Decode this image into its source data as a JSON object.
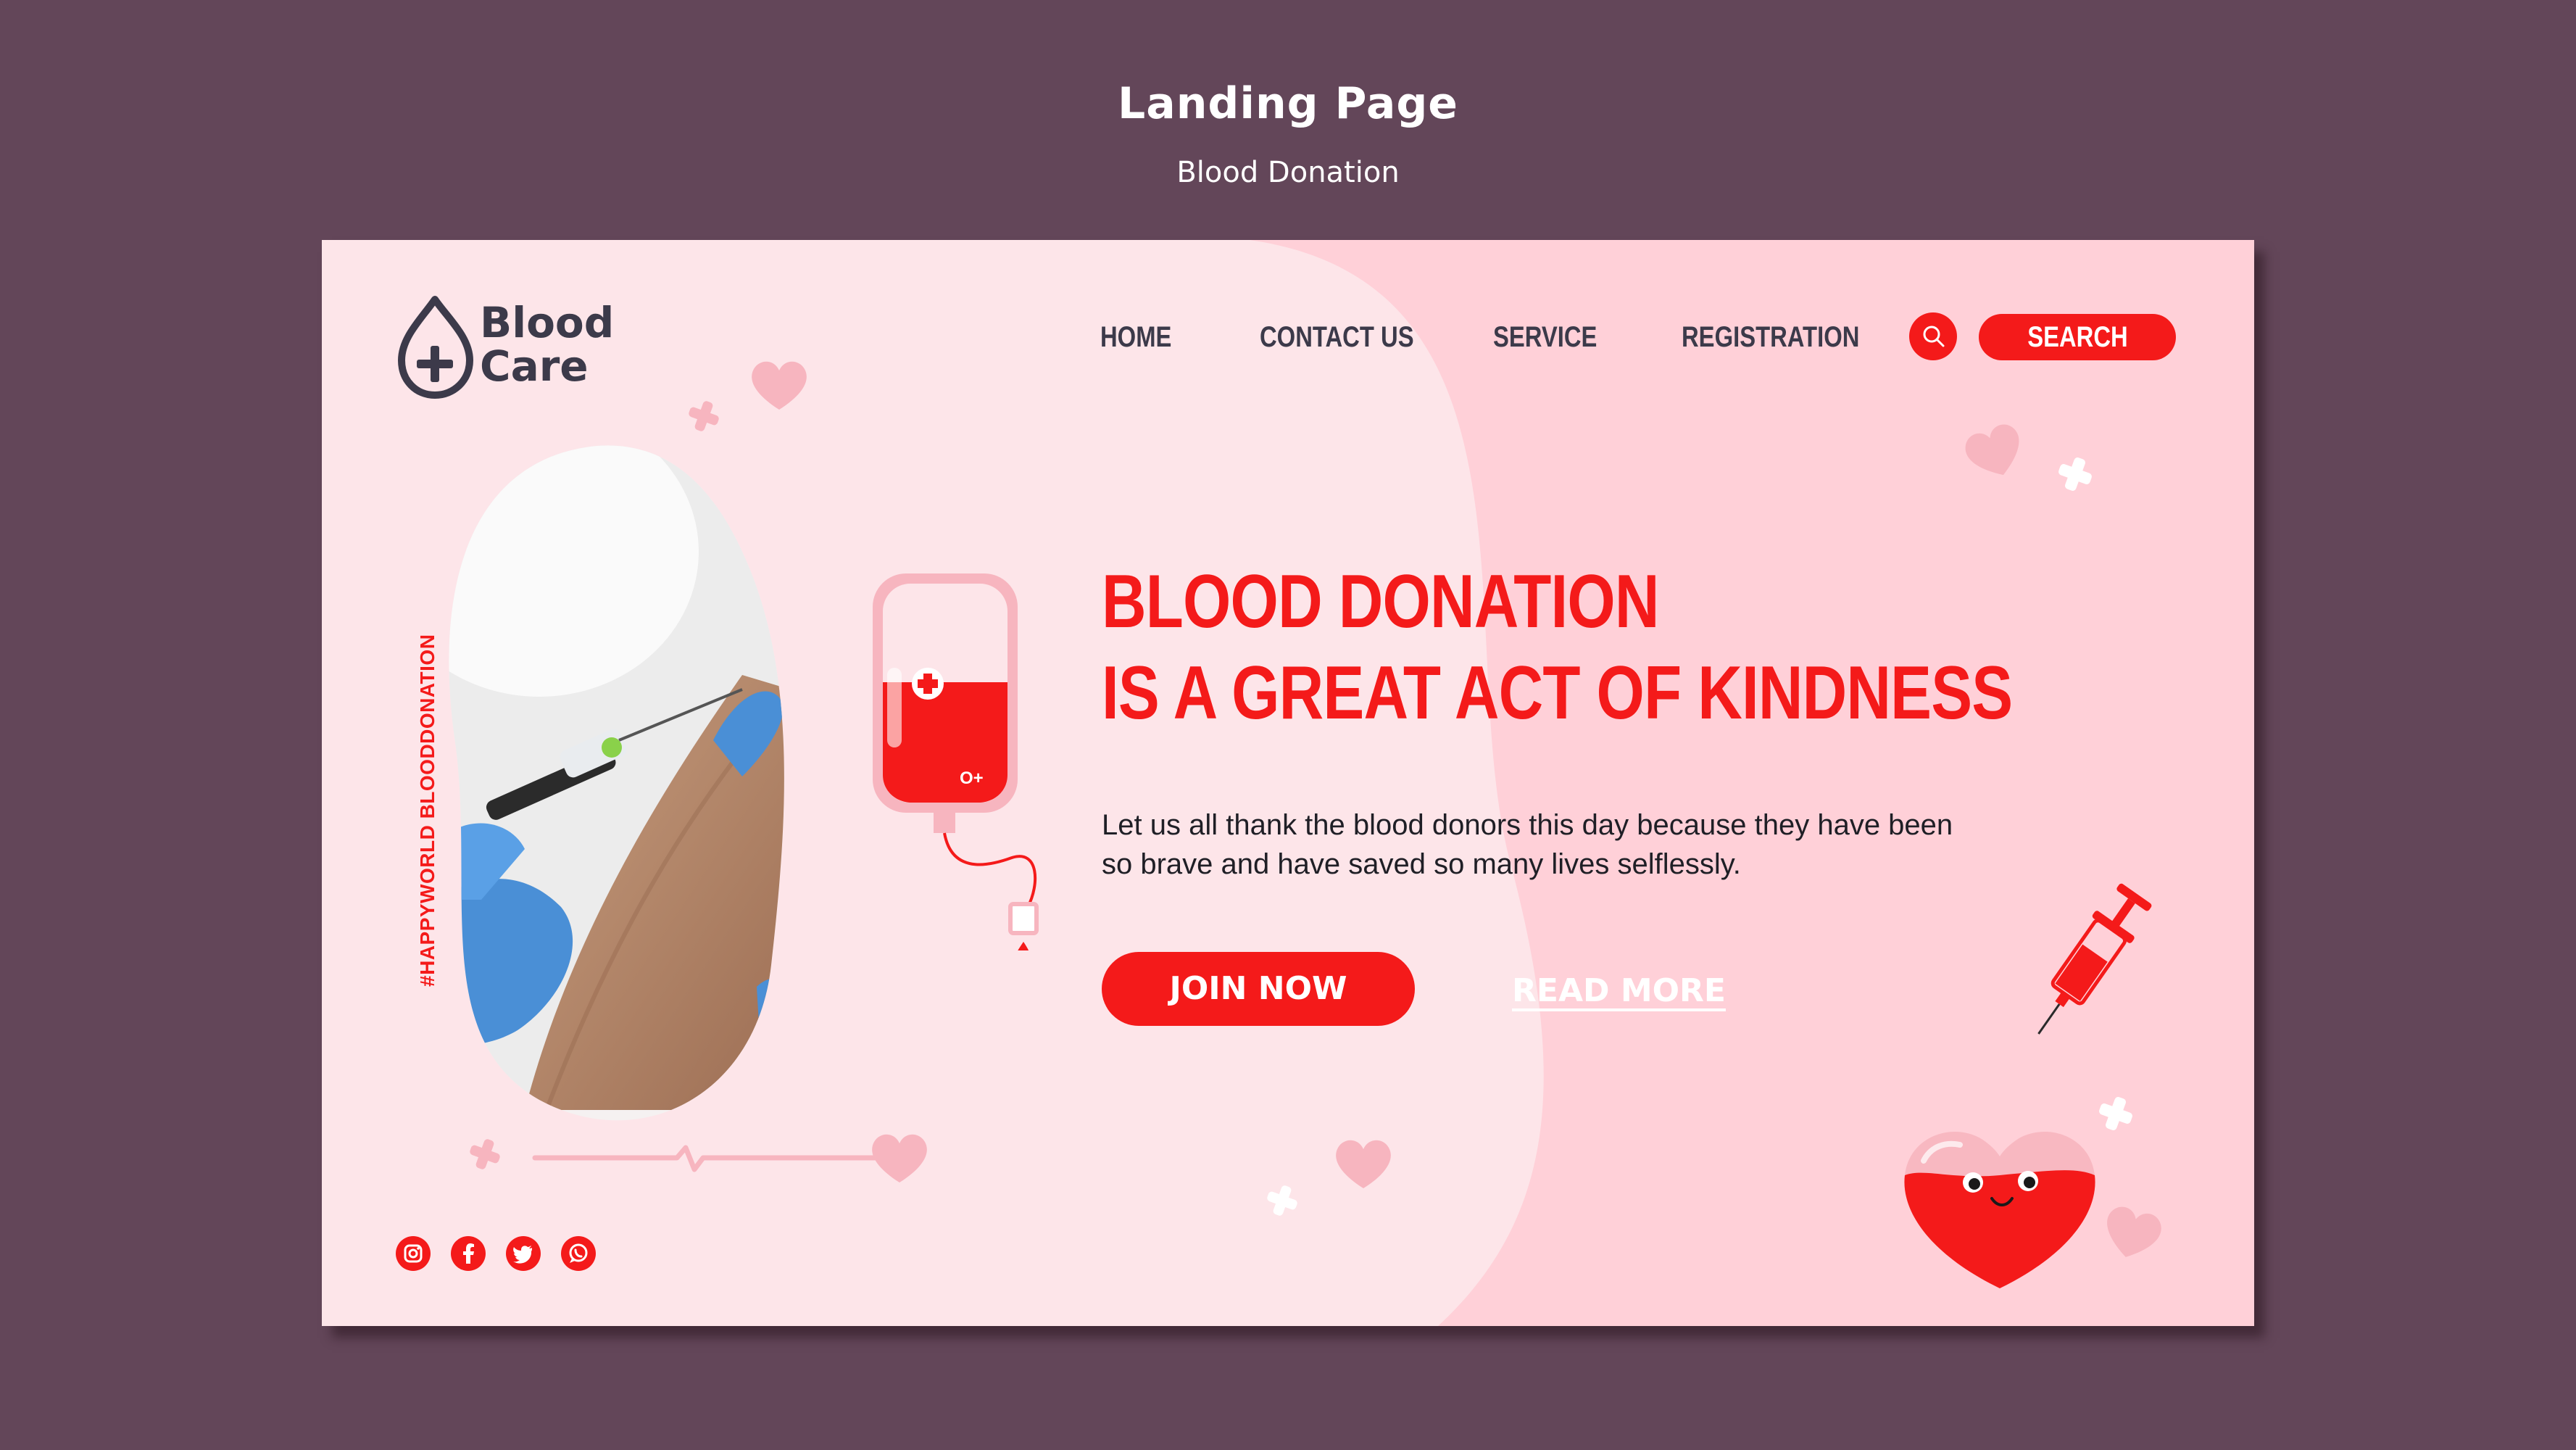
{
  "presentation": {
    "title": "Landing Page",
    "subtitle": "Blood Donation"
  },
  "logo": {
    "line1": "Blood",
    "line2": "Care",
    "icon": "blood-drop-plus-icon"
  },
  "nav": {
    "items": [
      {
        "label": "HOME"
      },
      {
        "label": "CONTACT US"
      },
      {
        "label": "SERVICE"
      },
      {
        "label": "REGISTRATION"
      }
    ],
    "search_icon": "search-icon",
    "search_label": "SEARCH"
  },
  "side_hashtag": "#HAPPYWORLD BLOODDONATION",
  "hero": {
    "title_line1": "BLOOD DONATION",
    "title_line2": "IS A GREAT ACT OF KINDNESS",
    "description": "Let us all thank the blood donors this day because they have been so brave and have saved so many lives selflessly.",
    "join_label": "JOIN NOW",
    "read_more_label": "READ MORE",
    "blood_bag_label": "O+"
  },
  "social": [
    "instagram-icon",
    "facebook-icon",
    "twitter-icon",
    "whatsapp-icon"
  ],
  "colors": {
    "page_background": "#634659",
    "card_background": "#fde5e9",
    "accent_pink": "#ffd0d8",
    "brand_red": "#f41a1a",
    "text_dark": "#3c3a4a",
    "soft_pink": "#f7b5bf"
  }
}
